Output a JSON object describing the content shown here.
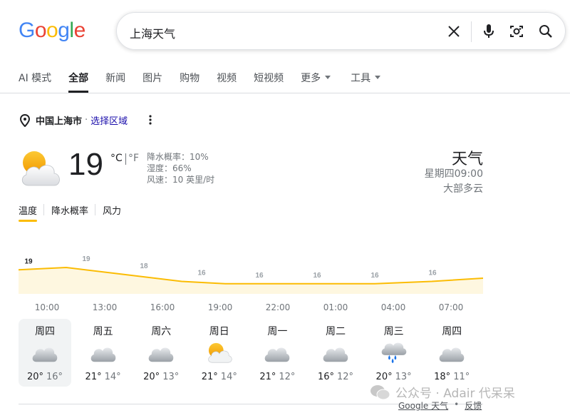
{
  "logo": {
    "letters": [
      "G",
      "o",
      "o",
      "g",
      "l",
      "e"
    ],
    "colors": [
      "#4285F4",
      "#EA4335",
      "#FBBC05",
      "#4285F4",
      "#34A853",
      "#EA4335"
    ]
  },
  "search": {
    "query": "上海天气"
  },
  "tabs": [
    {
      "label": "AI 模式",
      "active": false
    },
    {
      "label": "全部",
      "active": true
    },
    {
      "label": "新闻",
      "active": false
    },
    {
      "label": "图片",
      "active": false
    },
    {
      "label": "购物",
      "active": false
    },
    {
      "label": "视频",
      "active": false
    },
    {
      "label": "短视频",
      "active": false
    },
    {
      "label": "更多",
      "active": false,
      "dropdown": true
    },
    {
      "label": "工具",
      "active": false,
      "dropdown": true
    }
  ],
  "location": {
    "name": "中国上海市",
    "separator": "·",
    "region_link": "选择区域"
  },
  "current": {
    "icon": "partly-cloudy-icon",
    "temp": "19",
    "unit_c": "°C",
    "unit_f": "°F",
    "precip": "降水概率：10%",
    "humidity": "湿度：66%",
    "wind": "风速：10 英里/时"
  },
  "right": {
    "title": "天气",
    "time": "星期四09:00",
    "condition": "大部多云"
  },
  "metric_tabs": [
    {
      "label": "温度",
      "active": true
    },
    {
      "label": "降水概率",
      "active": false
    },
    {
      "label": "风力",
      "active": false
    }
  ],
  "chart_data": {
    "type": "area",
    "x": [
      "10:00",
      "13:00",
      "16:00",
      "19:00",
      "22:00",
      "01:00",
      "04:00",
      "07:00"
    ],
    "labels": [
      "19",
      "19",
      "18",
      "16",
      "16",
      "16",
      "16",
      "16"
    ],
    "values": [
      19,
      19.5,
      18,
      16.5,
      16,
      16,
      16,
      16.5
    ],
    "end_value": 17.2,
    "fill_color": "#fef7e0",
    "line_color": "#fbbc04"
  },
  "daily": [
    {
      "day": "周四",
      "icon": "cloudy-icon",
      "hi": "20°",
      "lo": "16°",
      "selected": true
    },
    {
      "day": "周五",
      "icon": "cloudy-icon",
      "hi": "21°",
      "lo": "14°",
      "selected": false
    },
    {
      "day": "周六",
      "icon": "cloudy-icon",
      "hi": "20°",
      "lo": "13°",
      "selected": false
    },
    {
      "day": "周日",
      "icon": "partly-cloudy-icon",
      "hi": "21°",
      "lo": "14°",
      "selected": false
    },
    {
      "day": "周一",
      "icon": "cloudy-icon",
      "hi": "21°",
      "lo": "12°",
      "selected": false
    },
    {
      "day": "周二",
      "icon": "cloudy-icon",
      "hi": "16°",
      "lo": "12°",
      "selected": false
    },
    {
      "day": "周三",
      "icon": "rain-icon",
      "hi": "20°",
      "lo": "13°",
      "selected": false
    },
    {
      "day": "周四",
      "icon": "cloudy-icon",
      "hi": "18°",
      "lo": "11°",
      "selected": false
    }
  ],
  "footer": {
    "source": "Google 天气",
    "dot": "•",
    "feedback": "反馈"
  },
  "watermark": "公众号 · Adair 代呆呆"
}
